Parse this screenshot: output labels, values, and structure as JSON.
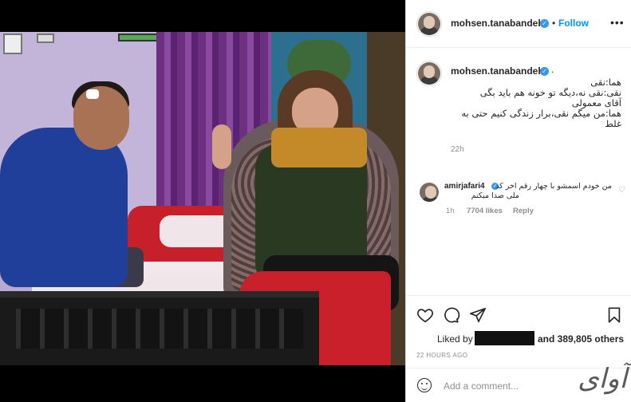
{
  "post": {
    "username": "mohsen.tanabandeh",
    "follow_label": "Follow",
    "dot": "•",
    "more": "•••",
    "caption_username": "mohsen.tanabandeh",
    "caption_period": ".",
    "caption_lines": [
      "هما:نقی",
      "نقی:نقی نه،دیگه تو خونه هم باید بگی",
      "آقای معمولی",
      "هما:من میگم نقی،برار زندگی کنیم حتی به",
      "غلط"
    ],
    "caption_time": "22h"
  },
  "comment": {
    "username": "amirjafari4",
    "text_line1": "من خودم اسمشو با چهار رقم اخر کد",
    "text_line2": "ملی صدا میکنم",
    "time": "1h",
    "likes": "7704 likes",
    "reply_label": "Reply"
  },
  "footer": {
    "liked_by_prefix": "Liked by",
    "liked_by_suffix": "and 389,805 others",
    "posted_ago": "22 HOURS AGO",
    "add_comment_placeholder": "Add a comment...",
    "watermark": "آوای"
  },
  "colors": {
    "accent": "#0095f6",
    "verified": "#3897f0",
    "text": "#262626",
    "muted": "#8e8e8e"
  },
  "icons": [
    "heart-icon",
    "comment-icon",
    "share-icon",
    "bookmark-icon",
    "emoji-icon",
    "more-icon",
    "verified-icon"
  ]
}
